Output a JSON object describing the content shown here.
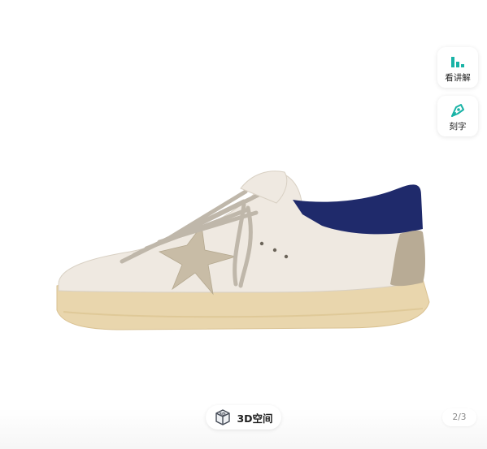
{
  "side_actions": [
    {
      "label": "看讲解",
      "icon": "bar-chart-icon",
      "color": "#19b3a6"
    },
    {
      "label": "刻字",
      "icon": "pen-nib-icon",
      "color": "#19b3a6"
    }
  ],
  "bottom": {
    "view_3d_label": "3D空间",
    "view_3d_icon": "3d-cube-icon",
    "page_current": "2",
    "page_total": "3",
    "page_text": "2/3"
  },
  "product_image": {
    "subject": "sneaker-photo",
    "colors": {
      "leather": "#efe9e1",
      "sole": "#e9d6ad",
      "star": "#c8bca6",
      "heel_tab": "#1f2a6b",
      "heel_suede": "#b8ab95",
      "laces": "#bfb7aa"
    }
  }
}
